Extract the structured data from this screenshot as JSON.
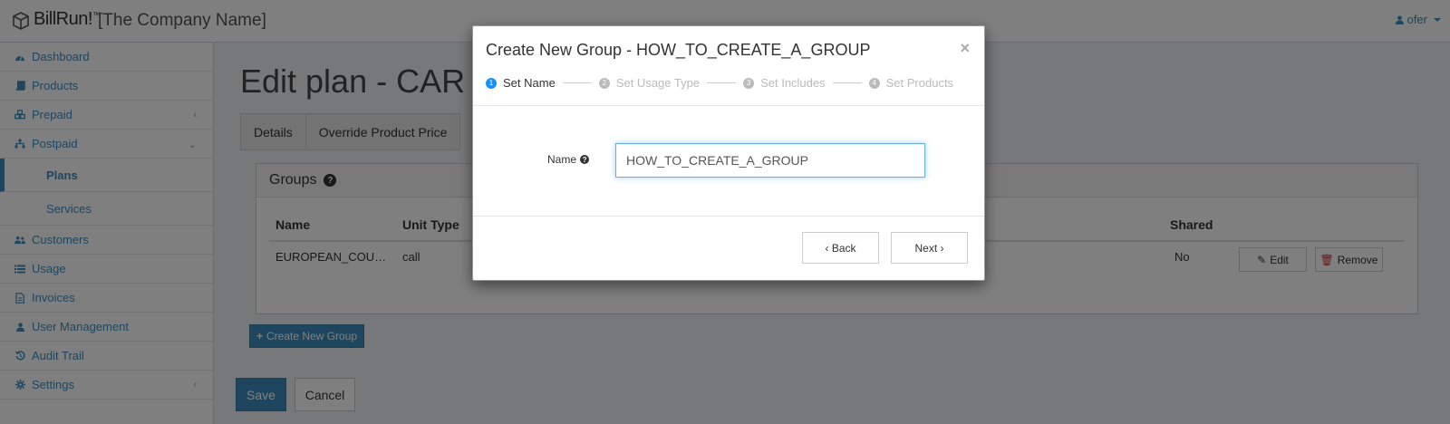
{
  "header": {
    "logo_text": "BillRun!",
    "logo_tm": "™",
    "company": "[The Company Name]",
    "user": "ofer"
  },
  "sidebar": {
    "items": [
      {
        "label": "Dashboard",
        "icon": "dashboard-icon"
      },
      {
        "label": "Products",
        "icon": "book-icon"
      },
      {
        "label": "Prepaid",
        "icon": "cubes-icon"
      },
      {
        "label": "Postpaid",
        "icon": "sitemap-icon"
      },
      {
        "label": "Plans"
      },
      {
        "label": "Services"
      },
      {
        "label": "Customers",
        "icon": "users-icon"
      },
      {
        "label": "Usage",
        "icon": "list-icon"
      },
      {
        "label": "Invoices",
        "icon": "file-icon"
      },
      {
        "label": "User Management",
        "icon": "user-icon"
      },
      {
        "label": "Audit Trail",
        "icon": "history-icon"
      },
      {
        "label": "Settings",
        "icon": "gear-icon"
      }
    ]
  },
  "main": {
    "title": "Edit plan - CAR",
    "tabs": [
      "Details",
      "Override Product Price"
    ],
    "groups": {
      "title": "Groups",
      "columns": {
        "name": "Name",
        "unit_type": "Unit Type",
        "shared": "Shared"
      },
      "rows": [
        {
          "name": "EUROPEAN_COU…",
          "unit_type": "call",
          "shared": "No"
        }
      ],
      "edit_label": "Edit",
      "remove_label": "Remove"
    },
    "create_group_label": "Create New Group",
    "save_label": "Save",
    "cancel_label": "Cancel"
  },
  "modal": {
    "title": "Create New Group - HOW_TO_CREATE_A_GROUP",
    "close": "×",
    "steps": [
      {
        "num": "1",
        "label": "Set Name"
      },
      {
        "num": "2",
        "label": "Set Usage Type"
      },
      {
        "num": "3",
        "label": "Set Includes"
      },
      {
        "num": "4",
        "label": "Set Products"
      }
    ],
    "name_label": "Name",
    "name_value": "HOW_TO_CREATE_A_GROUP",
    "back_label": "Back",
    "next_label": "Next"
  },
  "colors": {
    "accent": "#3c8dbc",
    "step_active": "#1890ff"
  }
}
